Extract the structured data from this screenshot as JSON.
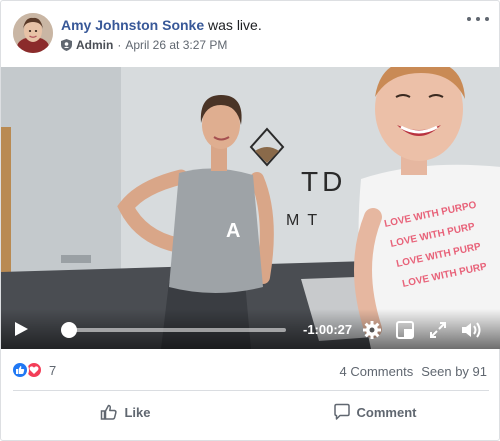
{
  "post": {
    "author": "Amy Johnston Sonke",
    "action_text": "was live.",
    "role": "Admin",
    "separator": "·",
    "date": "April 26 at 3:27 PM"
  },
  "video": {
    "time_remaining": "-1:00:27",
    "progress_fraction": 0.0,
    "wall_sign_left": "TD",
    "wall_sign_right": "MT",
    "shirt_text_lines": [
      "LOVE WITH PURPO",
      "LOVE WITH PURP",
      "LOVE WITH PURP",
      "LOVE WITH PURP"
    ],
    "tank_text": "A"
  },
  "stats": {
    "reaction_count": "7",
    "comments": "4 Comments",
    "seen": "Seen by 91"
  },
  "actions": {
    "like": "Like",
    "comment": "Comment"
  },
  "colors": {
    "author_link": "#385898",
    "like_blue": "#2078f4",
    "love_red": "#f33e58",
    "meta_gray": "#606770"
  }
}
